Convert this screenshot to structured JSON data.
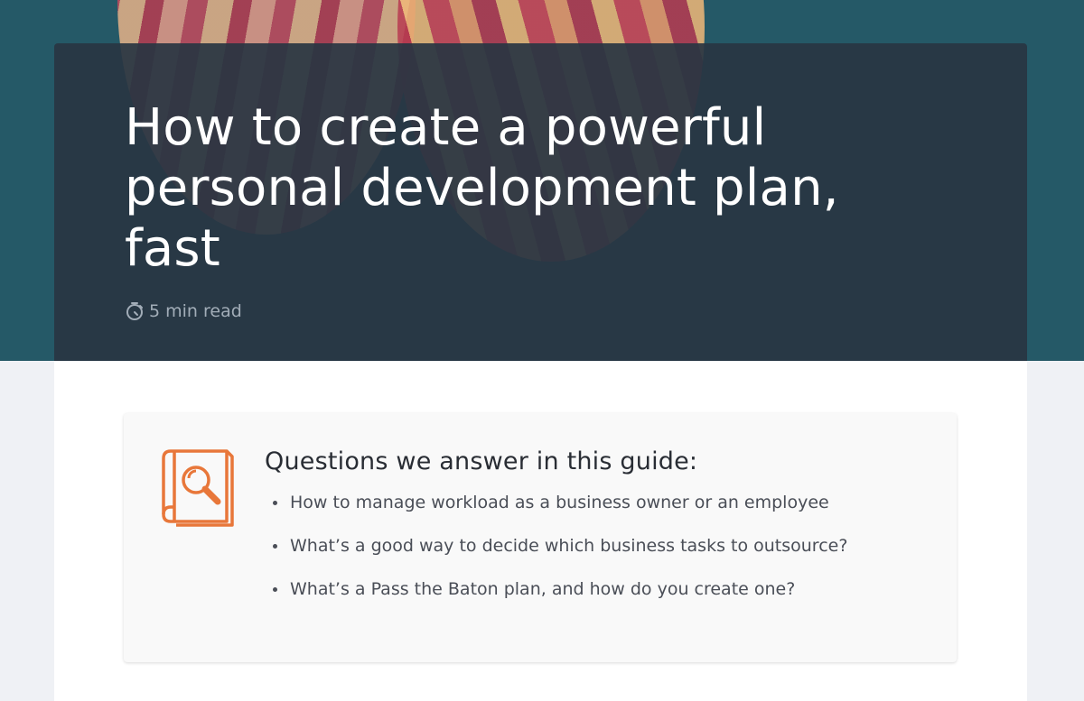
{
  "hero": {
    "title": "How to create a powerful personal development plan, fast",
    "read_time": "5 min read",
    "icon": "stopwatch-icon"
  },
  "guide": {
    "icon": "book-magnifier-icon",
    "accent_color": "#e8773a",
    "heading": "Questions we answer in this guide:",
    "items": [
      "How to manage workload as a business owner or an employee",
      "What’s a good way to decide which business tasks to outsource?",
      "What’s a Pass the Baton plan, and how do you create one?"
    ]
  }
}
